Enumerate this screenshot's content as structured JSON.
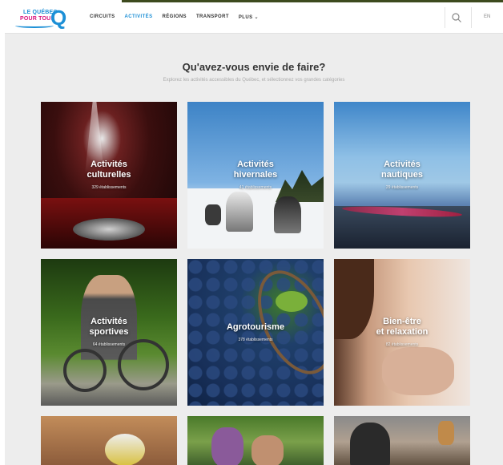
{
  "nav": {
    "logo_line1": "LE QUÉBEC",
    "logo_line2": "POUR TOUS",
    "logo_mark": "Q",
    "items": [
      "CIRCUITS",
      "ACTIVITÉS",
      "RÉGIONS",
      "TRANSPORT",
      "PLUS"
    ],
    "active_item": "ACTIVITÉS",
    "plus_caret": "⌄",
    "lang": "EN",
    "icons": {
      "search": "search-icon"
    },
    "accent_color": "#1c8fd6",
    "brand_pink": "#d7127d"
  },
  "main": {
    "heading": "Qu'avez-vous envie de faire?",
    "subheading": "Explorez les activités accessibles du Québec, et sélectionnez vos grandes catégories",
    "tiles": [
      {
        "title_line1": "Activités",
        "title_line2": "culturelles",
        "count": "329 établissements"
      },
      {
        "title_line1": "Activités",
        "title_line2": "hivernales",
        "count": "41 établissements"
      },
      {
        "title_line1": "Activités",
        "title_line2": "nautiques",
        "count": "29 établissements"
      },
      {
        "title_line1": "Activités",
        "title_line2": "sportives",
        "count": "64 établissements"
      },
      {
        "title_line1": "Agrotourisme",
        "title_line2": "",
        "count": "378 établissements"
      },
      {
        "title_line1": "Bien-être",
        "title_line2": "et relaxation",
        "count": "82 établissements"
      }
    ]
  }
}
